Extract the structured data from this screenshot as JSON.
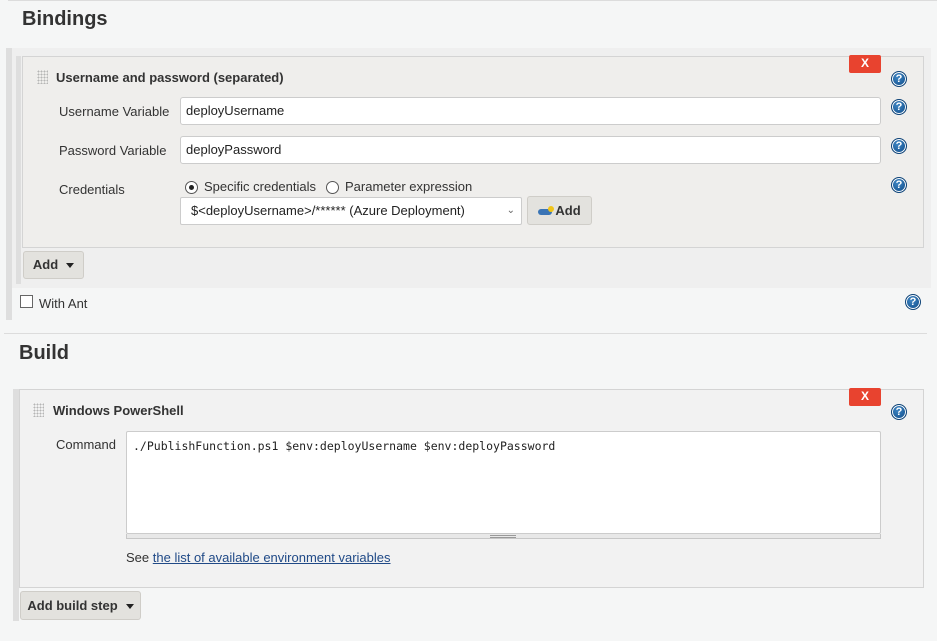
{
  "bindings": {
    "section_title": "Bindings",
    "binding": {
      "title": "Username and password (separated)",
      "delete_label": "X",
      "help_label": "?",
      "username_label": "Username Variable",
      "username_value": "deployUsername",
      "password_label": "Password Variable",
      "password_value": "deployPassword",
      "credentials_label": "Credentials",
      "radio_specific": "Specific credentials",
      "radio_parameter": "Parameter expression",
      "selected_radio": "Specific credentials",
      "credentials_selected": "$<deployUsername>/****** (Azure Deployment)",
      "add_credentials_label": "Add"
    },
    "add_label": "Add",
    "with_ant_label": "With Ant",
    "with_ant_checked": false
  },
  "build": {
    "section_title": "Build",
    "step": {
      "title": "Windows PowerShell",
      "delete_label": "X",
      "help_label": "?",
      "command_label": "Command",
      "command_value": "./PublishFunction.ps1 $env:deployUsername $env:deployPassword",
      "see_prefix": "See",
      "env_link": "the list of available environment variables"
    },
    "add_build_step_label": "Add build step"
  },
  "colors": {
    "delete_red": "#e8432f",
    "help_blue": "#1a5a98",
    "link_blue": "#204a87"
  }
}
